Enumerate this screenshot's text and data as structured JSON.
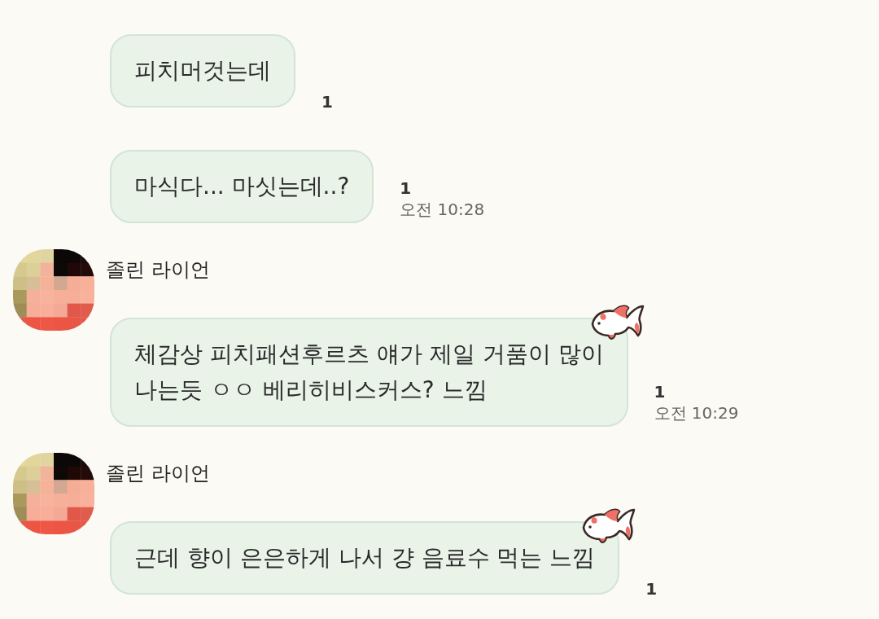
{
  "groups": [
    {
      "messages": [
        {
          "text": "피치머것는데",
          "unread": "1",
          "sticker": false
        },
        {
          "text": "마식다... 마싯는데..?",
          "unread": "1",
          "time": "오전 10:28",
          "sticker": false
        }
      ]
    },
    {
      "sender": "졸린 라이언",
      "messages": [
        {
          "text": "체감상 피치패션후르츠 얘가 제일 거품이 많이\n나는듯 ㅇㅇ 베리히비스커스? 느낌",
          "unread": "1",
          "time": "오전 10:29",
          "sticker": true
        }
      ]
    },
    {
      "sender": "졸린 라이언",
      "messages": [
        {
          "text": "근데 향이 은은하게 나서 걍 음료수 먹는 느낌",
          "unread": "1",
          "sticker": true
        }
      ]
    }
  ]
}
